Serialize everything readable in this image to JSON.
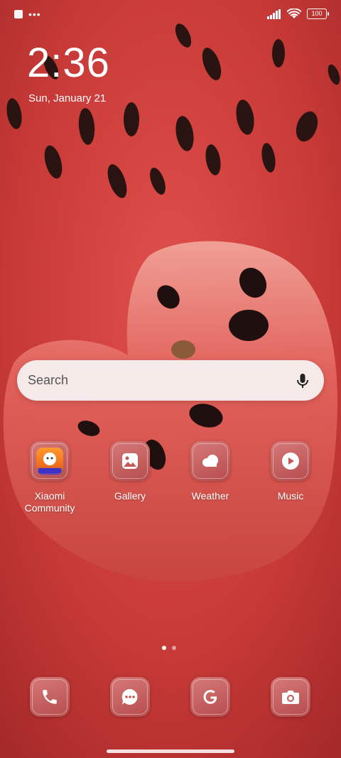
{
  "status_bar": {
    "battery": "100"
  },
  "clock": {
    "time": "2:36",
    "date": "Sun, January 21"
  },
  "search": {
    "placeholder": "Search"
  },
  "apps": [
    {
      "label": "Xiaomi\nCommunity",
      "icon": "xiaomi-community-icon"
    },
    {
      "label": "Gallery",
      "icon": "gallery-icon"
    },
    {
      "label": "Weather",
      "icon": "weather-icon"
    },
    {
      "label": "Music",
      "icon": "music-icon"
    }
  ],
  "page_indicator": {
    "pages": 2,
    "current": 1
  },
  "dock": [
    {
      "icon": "phone-icon"
    },
    {
      "icon": "messages-icon"
    },
    {
      "icon": "google-icon"
    },
    {
      "icon": "camera-icon"
    }
  ],
  "colors": {
    "wallpaper": "#c93a38",
    "icon_tile": "#c46060"
  }
}
